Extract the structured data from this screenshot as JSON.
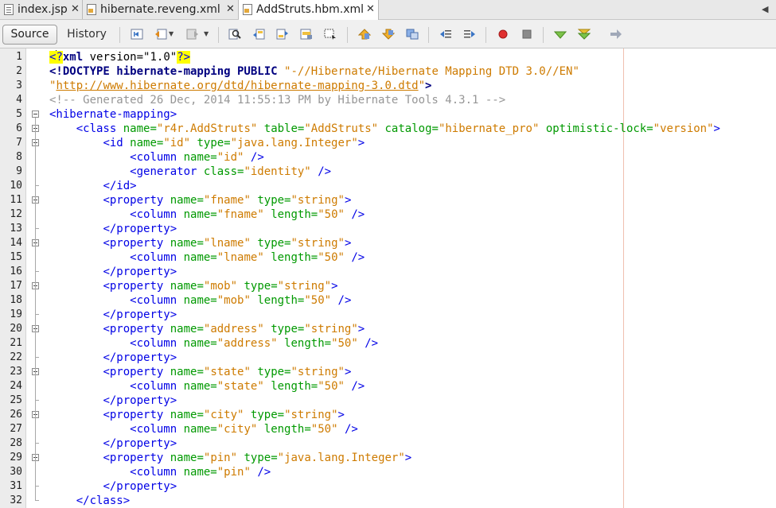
{
  "tabs": [
    {
      "label": "index.jsp",
      "icon": "jsp-file-icon"
    },
    {
      "label": "hibernate.reveng.xml",
      "icon": "xml-file-icon"
    },
    {
      "label": "AddStruts.hbm.xml",
      "icon": "xml-file-icon",
      "active": true
    }
  ],
  "toolbar": {
    "source_label": "Source",
    "history_label": "History",
    "icons": [
      "last-edit-icon",
      "back-icon",
      "forward-icon",
      "find-icon",
      "find-previous-icon",
      "find-next-icon",
      "toggle-highlight-icon",
      "toggle-rectangular-selection-icon",
      "previous-bookmark-icon",
      "next-bookmark-icon",
      "toggle-bookmark-icon",
      "shift-left-icon",
      "shift-right-icon",
      "start-macro-icon",
      "stop-macro-icon",
      "check-xml-icon",
      "validate-xml-icon",
      "xsl-transform-icon"
    ]
  },
  "editor": {
    "lines": [
      [
        [
          "hlb",
          "<"
        ],
        [
          "caret",
          ""
        ],
        [
          "hlb",
          "?"
        ],
        [
          "bold",
          "xml"
        ],
        [
          "plain",
          " version=\"1.0\""
        ],
        [
          "hlb",
          "?>"
        ]
      ],
      [
        [
          "bold",
          "<!DOCTYPE hibernate-mapping PUBLIC "
        ],
        [
          "val",
          "\"-//Hibernate/Hibernate Mapping DTD 3.0//EN\""
        ]
      ],
      [
        [
          "val",
          "\""
        ],
        [
          "url",
          "http://www.hibernate.org/dtd/hibernate-mapping-3.0.dtd"
        ],
        [
          "val",
          "\""
        ],
        [
          "bold",
          ">"
        ]
      ],
      [
        [
          "com",
          "<!-- Generated 26 Dec, 2014 11:55:13 PM by Hibernate Tools 4.3.1 -->"
        ]
      ],
      [
        [
          "tag",
          "<hibernate-mapping>"
        ]
      ],
      [
        [
          "plain",
          "    "
        ],
        [
          "tag",
          "<class "
        ],
        [
          "attr",
          "name="
        ],
        [
          "val",
          "\"r4r.AddStruts\""
        ],
        [
          "plain",
          " "
        ],
        [
          "attr",
          "table="
        ],
        [
          "val",
          "\"AddStruts\""
        ],
        [
          "plain",
          " "
        ],
        [
          "attr",
          "catalog="
        ],
        [
          "val",
          "\"hibernate_pro\""
        ],
        [
          "plain",
          " "
        ],
        [
          "attr",
          "optimistic-lock="
        ],
        [
          "val",
          "\"version\""
        ],
        [
          "tag",
          ">"
        ]
      ],
      [
        [
          "plain",
          "        "
        ],
        [
          "tag",
          "<id "
        ],
        [
          "attr",
          "name="
        ],
        [
          "val",
          "\"id\""
        ],
        [
          "plain",
          " "
        ],
        [
          "attr",
          "type="
        ],
        [
          "val",
          "\"java.lang.Integer\""
        ],
        [
          "tag",
          ">"
        ]
      ],
      [
        [
          "plain",
          "            "
        ],
        [
          "tag",
          "<column "
        ],
        [
          "attr",
          "name="
        ],
        [
          "val",
          "\"id\""
        ],
        [
          "plain",
          " "
        ],
        [
          "tag",
          "/>"
        ]
      ],
      [
        [
          "plain",
          "            "
        ],
        [
          "tag",
          "<generator "
        ],
        [
          "attr",
          "class="
        ],
        [
          "val",
          "\"identity\""
        ],
        [
          "plain",
          " "
        ],
        [
          "tag",
          "/>"
        ]
      ],
      [
        [
          "plain",
          "        "
        ],
        [
          "tag",
          "</id>"
        ]
      ],
      [
        [
          "plain",
          "        "
        ],
        [
          "tag",
          "<property "
        ],
        [
          "attr",
          "name="
        ],
        [
          "val",
          "\"fname\""
        ],
        [
          "plain",
          " "
        ],
        [
          "attr",
          "type="
        ],
        [
          "val",
          "\"string\""
        ],
        [
          "tag",
          ">"
        ]
      ],
      [
        [
          "plain",
          "            "
        ],
        [
          "tag",
          "<column "
        ],
        [
          "attr",
          "name="
        ],
        [
          "val",
          "\"fname\""
        ],
        [
          "plain",
          " "
        ],
        [
          "attr",
          "length="
        ],
        [
          "val",
          "\"50\""
        ],
        [
          "plain",
          " "
        ],
        [
          "tag",
          "/>"
        ]
      ],
      [
        [
          "plain",
          "        "
        ],
        [
          "tag",
          "</property>"
        ]
      ],
      [
        [
          "plain",
          "        "
        ],
        [
          "tag",
          "<property "
        ],
        [
          "attr",
          "name="
        ],
        [
          "val",
          "\"lname\""
        ],
        [
          "plain",
          " "
        ],
        [
          "attr",
          "type="
        ],
        [
          "val",
          "\"string\""
        ],
        [
          "tag",
          ">"
        ]
      ],
      [
        [
          "plain",
          "            "
        ],
        [
          "tag",
          "<column "
        ],
        [
          "attr",
          "name="
        ],
        [
          "val",
          "\"lname\""
        ],
        [
          "plain",
          " "
        ],
        [
          "attr",
          "length="
        ],
        [
          "val",
          "\"50\""
        ],
        [
          "plain",
          " "
        ],
        [
          "tag",
          "/>"
        ]
      ],
      [
        [
          "plain",
          "        "
        ],
        [
          "tag",
          "</property>"
        ]
      ],
      [
        [
          "plain",
          "        "
        ],
        [
          "tag",
          "<property "
        ],
        [
          "attr",
          "name="
        ],
        [
          "val",
          "\"mob\""
        ],
        [
          "plain",
          " "
        ],
        [
          "attr",
          "type="
        ],
        [
          "val",
          "\"string\""
        ],
        [
          "tag",
          ">"
        ]
      ],
      [
        [
          "plain",
          "            "
        ],
        [
          "tag",
          "<column "
        ],
        [
          "attr",
          "name="
        ],
        [
          "val",
          "\"mob\""
        ],
        [
          "plain",
          " "
        ],
        [
          "attr",
          "length="
        ],
        [
          "val",
          "\"50\""
        ],
        [
          "plain",
          " "
        ],
        [
          "tag",
          "/>"
        ]
      ],
      [
        [
          "plain",
          "        "
        ],
        [
          "tag",
          "</property>"
        ]
      ],
      [
        [
          "plain",
          "        "
        ],
        [
          "tag",
          "<property "
        ],
        [
          "attr",
          "name="
        ],
        [
          "val",
          "\"address\""
        ],
        [
          "plain",
          " "
        ],
        [
          "attr",
          "type="
        ],
        [
          "val",
          "\"string\""
        ],
        [
          "tag",
          ">"
        ]
      ],
      [
        [
          "plain",
          "            "
        ],
        [
          "tag",
          "<column "
        ],
        [
          "attr",
          "name="
        ],
        [
          "val",
          "\"address\""
        ],
        [
          "plain",
          " "
        ],
        [
          "attr",
          "length="
        ],
        [
          "val",
          "\"50\""
        ],
        [
          "plain",
          " "
        ],
        [
          "tag",
          "/>"
        ]
      ],
      [
        [
          "plain",
          "        "
        ],
        [
          "tag",
          "</property>"
        ]
      ],
      [
        [
          "plain",
          "        "
        ],
        [
          "tag",
          "<property "
        ],
        [
          "attr",
          "name="
        ],
        [
          "val",
          "\"state\""
        ],
        [
          "plain",
          " "
        ],
        [
          "attr",
          "type="
        ],
        [
          "val",
          "\"string\""
        ],
        [
          "tag",
          ">"
        ]
      ],
      [
        [
          "plain",
          "            "
        ],
        [
          "tag",
          "<column "
        ],
        [
          "attr",
          "name="
        ],
        [
          "val",
          "\"state\""
        ],
        [
          "plain",
          " "
        ],
        [
          "attr",
          "length="
        ],
        [
          "val",
          "\"50\""
        ],
        [
          "plain",
          " "
        ],
        [
          "tag",
          "/>"
        ]
      ],
      [
        [
          "plain",
          "        "
        ],
        [
          "tag",
          "</property>"
        ]
      ],
      [
        [
          "plain",
          "        "
        ],
        [
          "tag",
          "<property "
        ],
        [
          "attr",
          "name="
        ],
        [
          "val",
          "\"city\""
        ],
        [
          "plain",
          " "
        ],
        [
          "attr",
          "type="
        ],
        [
          "val",
          "\"string\""
        ],
        [
          "tag",
          ">"
        ]
      ],
      [
        [
          "plain",
          "            "
        ],
        [
          "tag",
          "<column "
        ],
        [
          "attr",
          "name="
        ],
        [
          "val",
          "\"city\""
        ],
        [
          "plain",
          " "
        ],
        [
          "attr",
          "length="
        ],
        [
          "val",
          "\"50\""
        ],
        [
          "plain",
          " "
        ],
        [
          "tag",
          "/>"
        ]
      ],
      [
        [
          "plain",
          "        "
        ],
        [
          "tag",
          "</property>"
        ]
      ],
      [
        [
          "plain",
          "        "
        ],
        [
          "tag",
          "<property "
        ],
        [
          "attr",
          "name="
        ],
        [
          "val",
          "\"pin\""
        ],
        [
          "plain",
          " "
        ],
        [
          "attr",
          "type="
        ],
        [
          "val",
          "\"java.lang.Integer\""
        ],
        [
          "tag",
          ">"
        ]
      ],
      [
        [
          "plain",
          "            "
        ],
        [
          "tag",
          "<column "
        ],
        [
          "attr",
          "name="
        ],
        [
          "val",
          "\"pin\""
        ],
        [
          "plain",
          " "
        ],
        [
          "tag",
          "/>"
        ]
      ],
      [
        [
          "plain",
          "        "
        ],
        [
          "tag",
          "</property>"
        ]
      ],
      [
        [
          "plain",
          "    "
        ],
        [
          "tag",
          "</class>"
        ]
      ]
    ],
    "line_numbers": [
      "1",
      "2",
      "3",
      "4",
      "5",
      "6",
      "7",
      "8",
      "9",
      "10",
      "11",
      "12",
      "13",
      "14",
      "15",
      "16",
      "17",
      "18",
      "19",
      "20",
      "21",
      "22",
      "23",
      "24",
      "25",
      "26",
      "27",
      "28",
      "29",
      "30",
      "31",
      "32"
    ],
    "fold_open_lines": [
      5,
      6,
      7,
      11,
      14,
      17,
      20,
      23,
      26,
      29
    ],
    "fold_end_lines": [
      10,
      13,
      16,
      19,
      22,
      25,
      28,
      31,
      32
    ]
  },
  "colors": {
    "tag": "#0000e6",
    "attr": "#009900",
    "value": "#ce7b00",
    "comment": "#969696",
    "highlight": "#ffff00"
  }
}
